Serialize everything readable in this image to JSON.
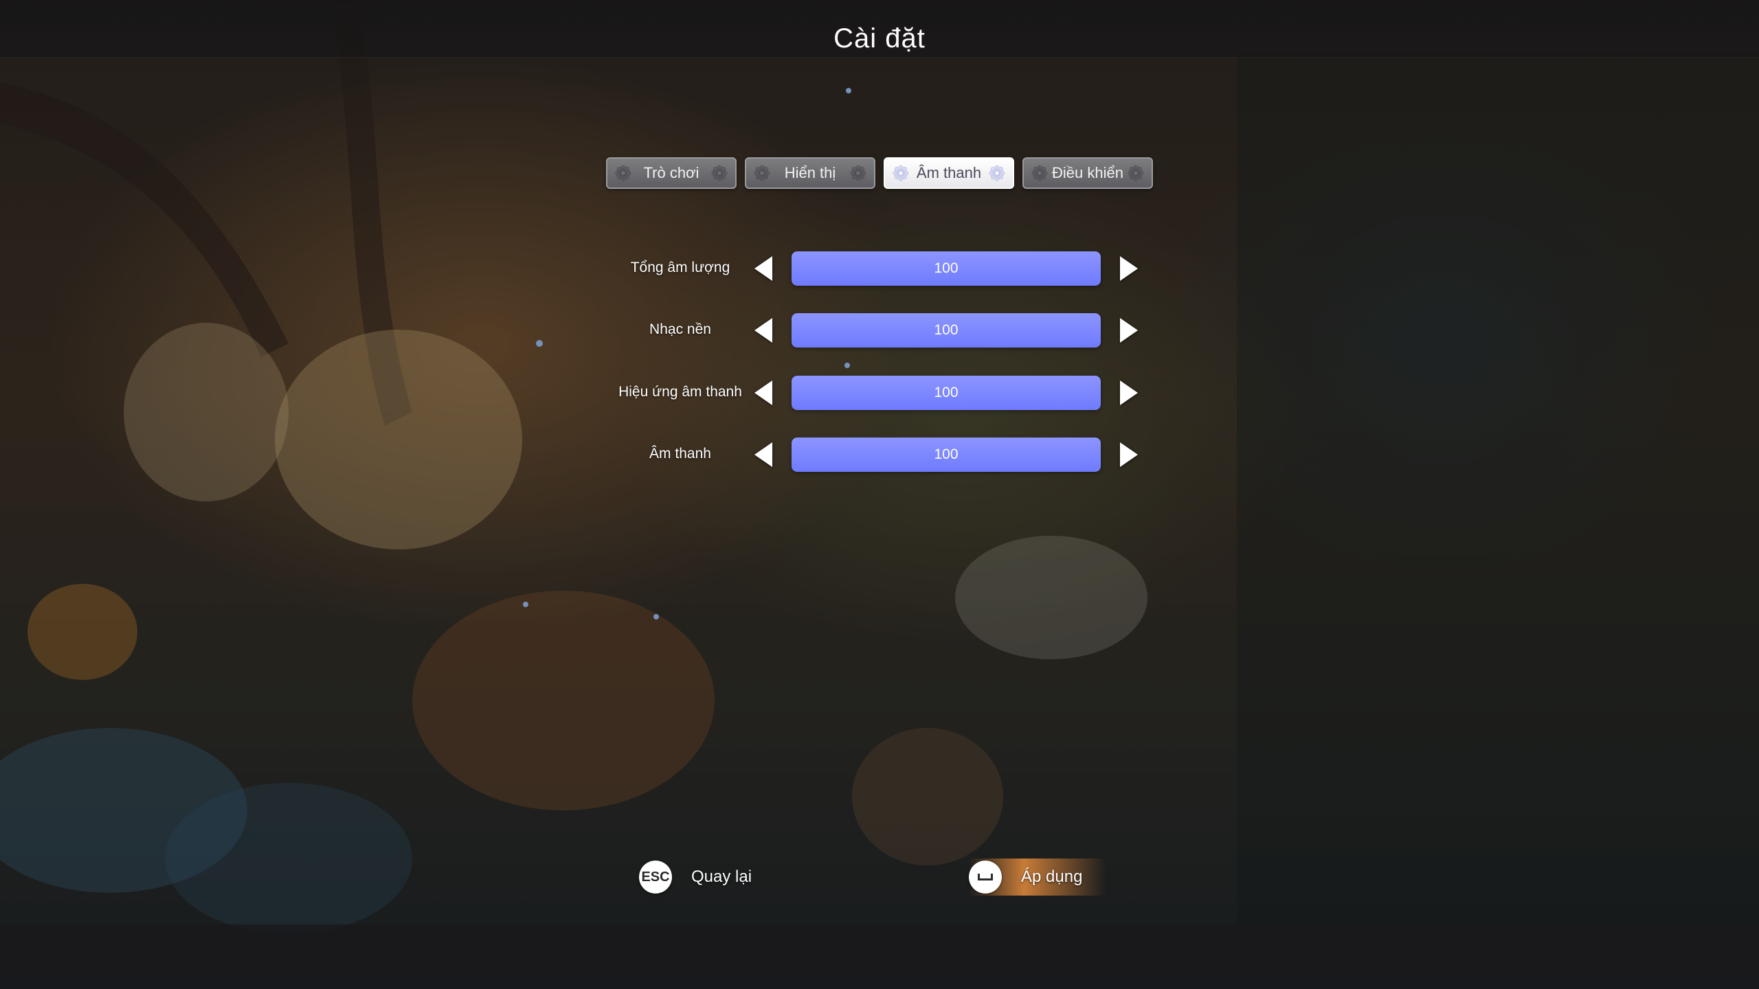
{
  "header": {
    "title": "Cài đặt"
  },
  "tabs": [
    {
      "label": "Trò chơi",
      "active": false
    },
    {
      "label": "Hiển thị",
      "active": false
    },
    {
      "label": "Âm thanh",
      "active": true
    },
    {
      "label": "Điều khiển",
      "active": false
    }
  ],
  "settings": [
    {
      "label": "Tổng âm lượng",
      "value": "100",
      "level": 1.0
    },
    {
      "label": "Nhạc nền",
      "value": "100",
      "level": 1.0
    },
    {
      "label": "Hiệu ứng âm thanh",
      "value": "100",
      "level": 1.0
    },
    {
      "label": "Âm thanh",
      "value": "100",
      "level": 1.0
    }
  ],
  "footer": {
    "back": {
      "key": "ESC",
      "label": "Quay lại"
    },
    "apply": {
      "key_icon": "spacebar-icon",
      "label": "Áp dụng"
    }
  },
  "colors": {
    "slider_fill": "#7b86ff",
    "active_tab": "#ffffff",
    "apply_highlight": "#e68c3c"
  },
  "icons": {
    "tab_decoration": "flower-icon",
    "decrease": "arrow-left-icon",
    "increase": "arrow-right-icon"
  }
}
